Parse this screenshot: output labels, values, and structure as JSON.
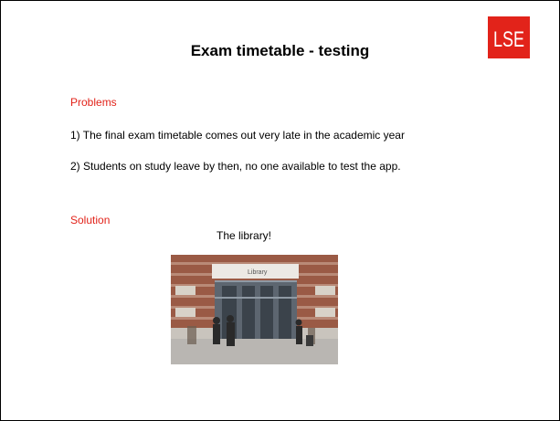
{
  "slide": {
    "title": "Exam timetable - testing",
    "logo_text": "LSE",
    "problems_heading": "Problems",
    "problem_1": "1) The final exam timetable comes out very late in the academic year",
    "problem_2": "2) Students on study leave by then, no one available to test the app.",
    "solution_heading": "Solution",
    "solution_text": "The library!",
    "photo_sign": "Library",
    "colors": {
      "accent": "#e2231a",
      "text": "#000000"
    }
  }
}
